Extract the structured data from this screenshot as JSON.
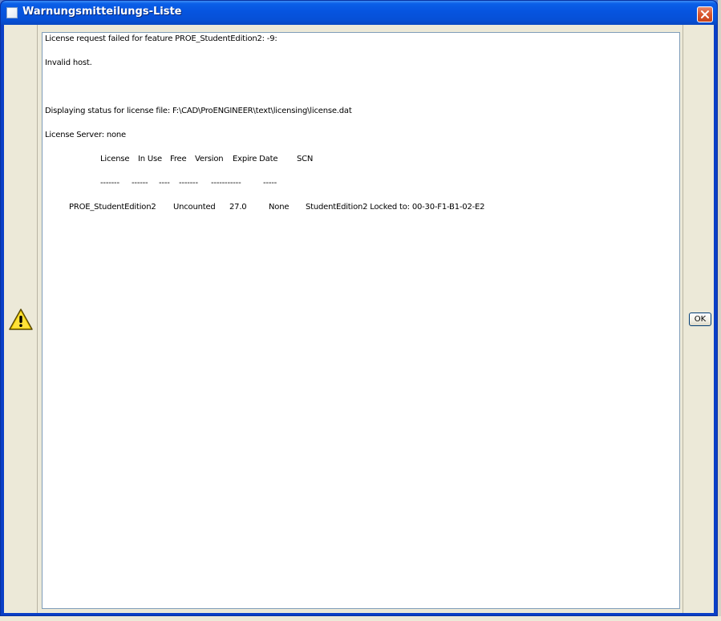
{
  "window": {
    "title": "Warnungsmitteilungs-Liste",
    "titlebar_color": "#0654df",
    "body_color": "#ece9d8"
  },
  "icons": {
    "warning": "warning-triangle-icon",
    "close": "close-x-icon",
    "app": "window-app-icon"
  },
  "message": {
    "line1": "License request failed for feature PROE_StudentEdition2: -9:",
    "line2": "Invalid host.",
    "line3": "Displaying status for license file: F:\\CAD\\ProENGINEER\\text\\licensing\\license.dat",
    "line4": "License Server: none",
    "table": {
      "headers": [
        "License",
        "In Use",
        "Free",
        "Version",
        "Expire Date",
        "SCN"
      ],
      "separators": [
        "-------",
        "------",
        "----",
        "-------",
        "-----------",
        "-----"
      ],
      "row": {
        "feature": "PROE_StudentEdition2",
        "in_use": "Uncounted",
        "version": "27.0",
        "expire": "None",
        "scn": "StudentEdition2 Locked to: 00-30-F1-B1-02-E2"
      }
    }
  },
  "buttons": {
    "ok_label": "OK"
  }
}
